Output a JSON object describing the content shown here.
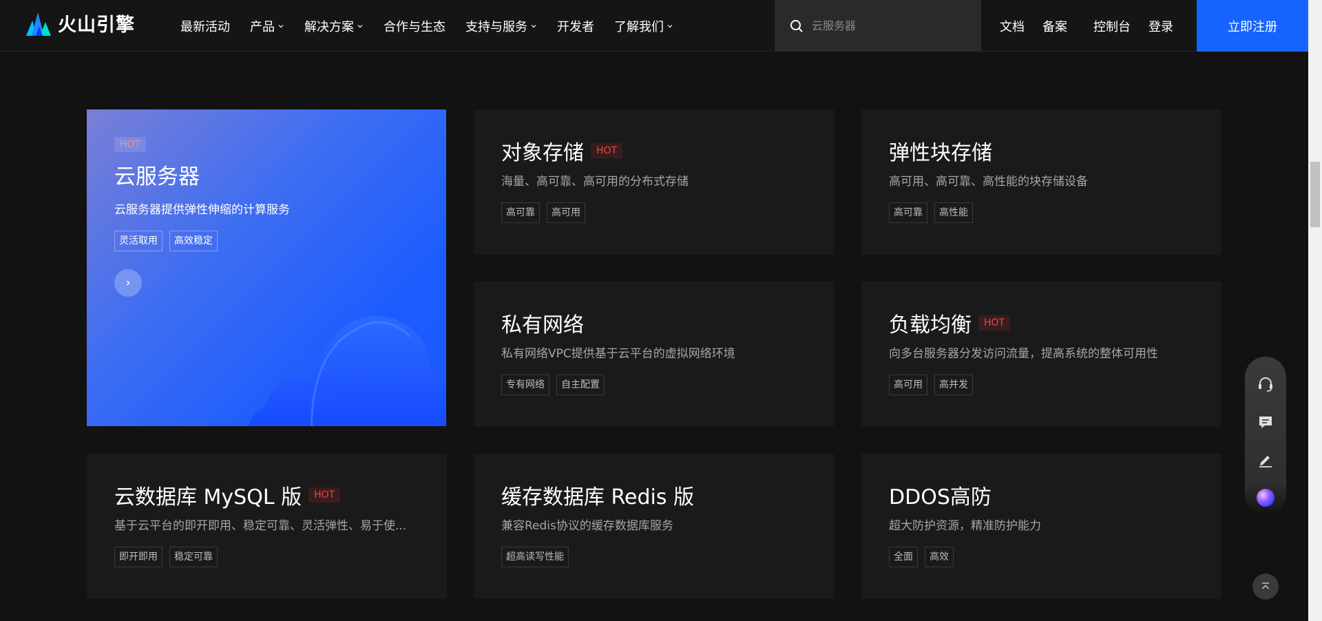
{
  "header": {
    "logo_text": "火山引擎",
    "nav": [
      "最新活动",
      "产品",
      "解决方案",
      "合作与生态",
      "支持与服务",
      "开发者",
      "了解我们"
    ],
    "search_placeholder": "云服务器",
    "links": [
      "文档",
      "备案",
      "控制台",
      "登录"
    ],
    "register_label": "立即注册"
  },
  "feature": {
    "hot": "HOT",
    "title": "云服务器",
    "desc": "云服务器提供弹性伸缩的计算服务",
    "tags": [
      "灵活取用",
      "高效稳定"
    ]
  },
  "cards": [
    {
      "title": "对象存储",
      "hot": "HOT",
      "desc": "海量、高可靠、高可用的分布式存储",
      "tags": [
        "高可靠",
        "高可用"
      ]
    },
    {
      "title": "弹性块存储",
      "hot": "",
      "desc": "高可用、高可靠、高性能的块存储设备",
      "tags": [
        "高可靠",
        "高性能"
      ]
    },
    {
      "title": "私有网络",
      "hot": "",
      "desc": "私有网络VPC提供基于云平台的虚拟网络环境",
      "tags": [
        "专有网络",
        "自主配置"
      ]
    },
    {
      "title": "负载均衡",
      "hot": "HOT",
      "desc": "向多台服务器分发访问流量，提高系统的整体可用性",
      "tags": [
        "高可用",
        "高并发"
      ]
    },
    {
      "title": "云数据库 MySQL 版",
      "hot": "HOT",
      "desc": "基于云平台的即开即用、稳定可靠、灵活弹性、易于使...",
      "tags": [
        "即开即用",
        "稳定可靠"
      ]
    },
    {
      "title": "缓存数据库 Redis 版",
      "hot": "",
      "desc": "兼容Redis协议的缓存数据库服务",
      "tags": [
        "超高读写性能"
      ]
    },
    {
      "title": "DDOS高防",
      "hot": "",
      "desc": "超大防护资源，精准防护能力",
      "tags": [
        "全面",
        "高效"
      ]
    }
  ],
  "colors": {
    "accent": "#1664ff",
    "hot": "#e5484d",
    "background": "#121212",
    "card": "#1a1a1a"
  }
}
